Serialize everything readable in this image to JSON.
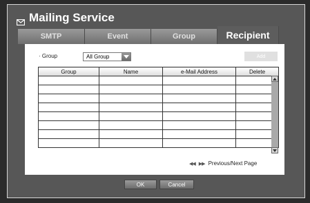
{
  "window": {
    "title": "Mailing Service"
  },
  "tabs": [
    {
      "label": "SMTP"
    },
    {
      "label": "Event"
    },
    {
      "label": "Group"
    },
    {
      "label": "Recipient",
      "active": true
    }
  ],
  "filter": {
    "label": "· Group",
    "selected": "All Group"
  },
  "add_label": "Add",
  "table": {
    "columns": [
      "Group",
      "Name",
      "e-Mail Address",
      "Delete"
    ],
    "rows": []
  },
  "pager": {
    "label": "Previous/Next Page"
  },
  "footer": {
    "ok_label": "OK",
    "cancel_label": "Cancel"
  }
}
